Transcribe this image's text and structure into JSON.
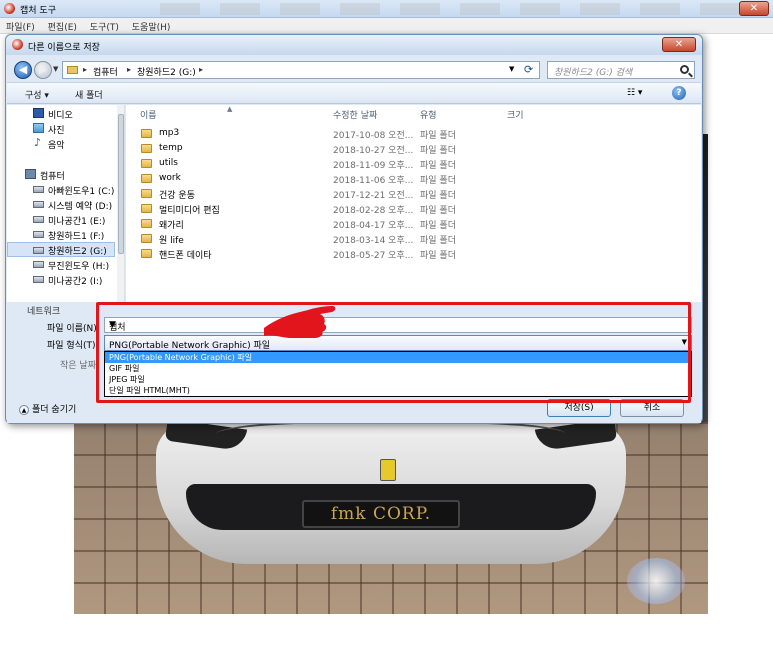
{
  "background_app": {
    "title": "캡처 도구",
    "menu": [
      "파일(F)",
      "편집(E)",
      "도구(T)",
      "도움말(H)"
    ],
    "close_glyph": "✕"
  },
  "photo": {
    "plate_text": "fmk CORP."
  },
  "dialog": {
    "title": "다른 이름으로 저장",
    "close_glyph": "✕",
    "address": {
      "segments": [
        "컴퓨터",
        "창원하드2 (G:)"
      ],
      "separator": "▸"
    },
    "search_placeholder": "창원하드2 (G:) 검색",
    "toolbar": {
      "organize": "구성 ▾",
      "new_folder": "새 폴더",
      "view": "☷ ▾",
      "help": "?"
    },
    "nav": [
      {
        "label": "비디오",
        "icon": "video-icon"
      },
      {
        "label": "사진",
        "icon": "photo-icon"
      },
      {
        "label": "음악",
        "icon": "music-icon"
      },
      {
        "label": "컴퓨터",
        "icon": "computer-icon"
      },
      {
        "label": "아빠윈도우1 (C:)",
        "icon": "drive-icon"
      },
      {
        "label": "시스템 예약 (D:)",
        "icon": "drive-icon"
      },
      {
        "label": "미나공간1 (E:)",
        "icon": "drive-icon"
      },
      {
        "label": "창원하드1 (F:)",
        "icon": "drive-icon"
      },
      {
        "label": "창원하드2 (G:)",
        "icon": "drive-icon",
        "selected": true
      },
      {
        "label": "무진윈도우 (H:)",
        "icon": "drive-icon"
      },
      {
        "label": "미나공간2 (I:)",
        "icon": "drive-icon"
      }
    ],
    "network_label": "네트워크",
    "columns": {
      "name": "이름",
      "modified": "수정한 날짜",
      "type": "유형",
      "size": "크기"
    },
    "files": [
      {
        "name": "mp3",
        "modified": "2017-10-08 오전...",
        "type": "파일 폴더"
      },
      {
        "name": "temp",
        "modified": "2018-10-27 오전...",
        "type": "파일 폴더"
      },
      {
        "name": "utils",
        "modified": "2018-11-09 오후...",
        "type": "파일 폴더"
      },
      {
        "name": "work",
        "modified": "2018-11-06 오후...",
        "type": "파일 폴더"
      },
      {
        "name": "건강 운동",
        "modified": "2017-12-21 오전...",
        "type": "파일 폴더"
      },
      {
        "name": "멀티미디어 편집",
        "modified": "2018-02-28 오후...",
        "type": "파일 폴더"
      },
      {
        "name": "왜가리",
        "modified": "2018-04-17 오후...",
        "type": "파일 폴더"
      },
      {
        "name": "원 life",
        "modified": "2018-03-14 오후...",
        "type": "파일 폴더"
      },
      {
        "name": "핸드폰 데이타",
        "modified": "2018-05-27 오후...",
        "type": "파일 폴더"
      }
    ],
    "form": {
      "filename_label": "파일 이름(N):",
      "filename_value": "캡처",
      "filetype_label": "파일 형식(T):",
      "filetype_value": "PNG(Portable Network Graphic) 파일",
      "author_label": "작은 날짜",
      "filetype_options": [
        "PNG(Portable Network Graphic) 파일",
        "GIF 파일",
        "JPEG 파일",
        "단일 파일 HTML(MHT)"
      ],
      "hide_folders": "폴더 숨기기",
      "save": "저장(S)",
      "cancel": "취소"
    }
  },
  "colors": {
    "highlight": "#e1151b",
    "selection": "#3399ff"
  }
}
